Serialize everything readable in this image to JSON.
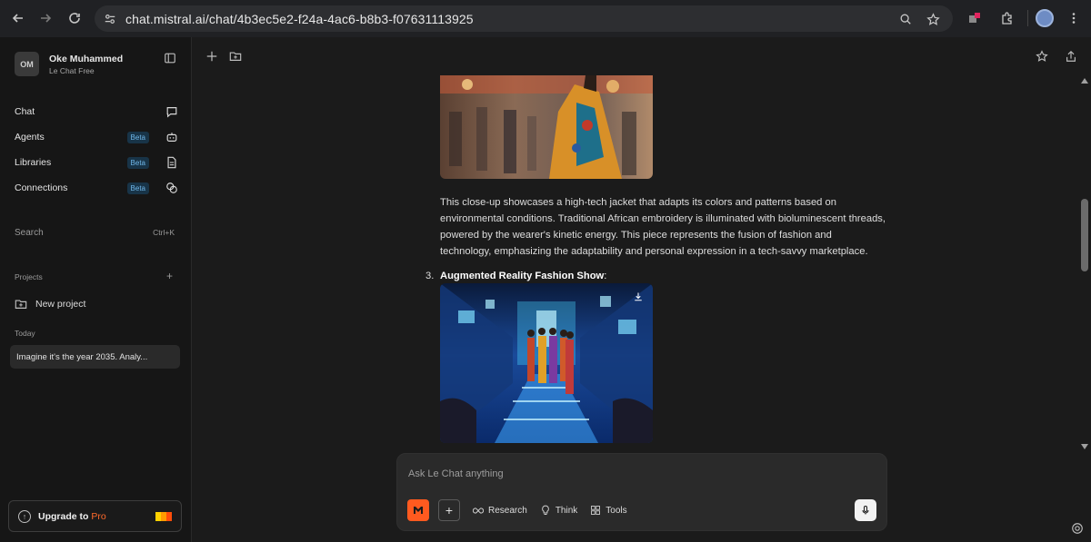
{
  "browser": {
    "url_host": "chat.mistral.ai",
    "url_path": "/chat/4b3ec5e2-f24a-4ac6-b8b3-f07631113925"
  },
  "sidebar": {
    "profile": {
      "initials": "OM",
      "name": "Oke Muhammed",
      "plan": "Le Chat Free"
    },
    "nav": [
      {
        "label": "Chat",
        "badge": "",
        "icon": "chat-bubble-icon"
      },
      {
        "label": "Agents",
        "badge": "Beta",
        "icon": "robot-icon"
      },
      {
        "label": "Libraries",
        "badge": "Beta",
        "icon": "document-icon"
      },
      {
        "label": "Connections",
        "badge": "Beta",
        "icon": "link-icon"
      }
    ],
    "search": {
      "label": "Search",
      "shortcut": "Ctrl+K"
    },
    "projects_label": "Projects",
    "new_project": "New project",
    "today_label": "Today",
    "history": [
      "Imagine it's the year 2035. Analy..."
    ],
    "upgrade": {
      "label": "Upgrade to",
      "highlight": "Pro"
    }
  },
  "conversation": {
    "paragraph": "This close-up showcases a high-tech jacket that adapts its colors and patterns based on environmental conditions. Traditional African embroidery is illuminated with bioluminescent threads, powered by the wearer's kinetic energy. This piece represents the fusion of fashion and technology, emphasizing the adaptability and personal expression in a tech-savvy marketplace.",
    "list_item_number": "3.",
    "list_item_title": "Augmented Reality Fashion Show",
    "list_item_suffix": ":"
  },
  "composer": {
    "placeholder": "Ask Le Chat anything",
    "tools": [
      {
        "label": "Research",
        "icon": "infinity-icon"
      },
      {
        "label": "Think",
        "icon": "lightbulb-icon"
      },
      {
        "label": "Tools",
        "icon": "grid-icon"
      }
    ]
  },
  "colors": {
    "accent": "#ff5a1f",
    "beta_badge": "#6fb6e8",
    "pro": "#ff6a2b"
  }
}
